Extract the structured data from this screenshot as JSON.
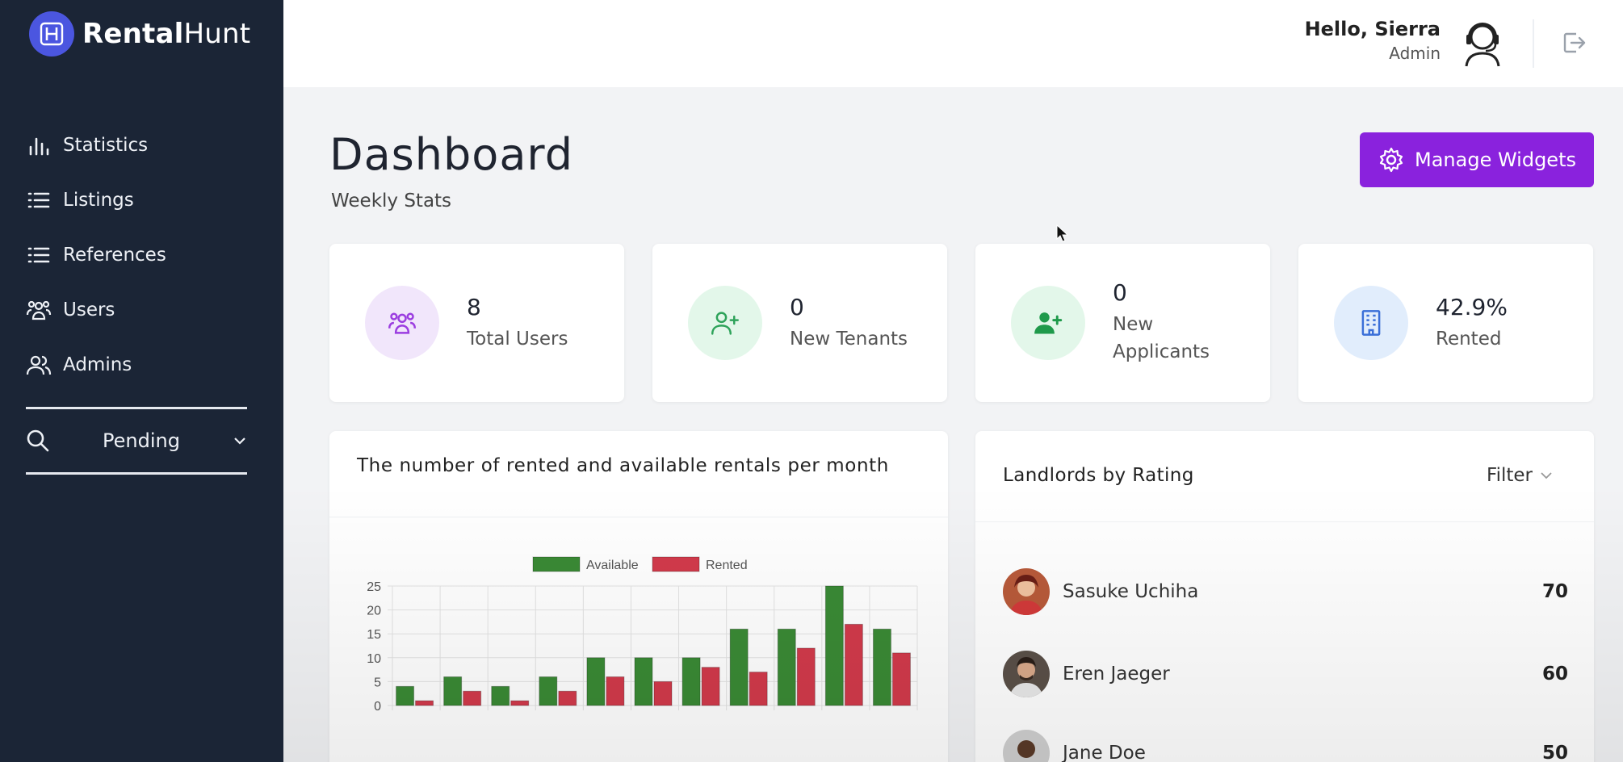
{
  "brand": {
    "bold": "Rental",
    "light": "Hunt"
  },
  "sidebar": {
    "items": [
      {
        "label": "Statistics",
        "icon": "bar-chart-icon"
      },
      {
        "label": "Listings",
        "icon": "list-icon"
      },
      {
        "label": "References",
        "icon": "list-icon"
      },
      {
        "label": "Users",
        "icon": "users-group-icon"
      },
      {
        "label": "Admins",
        "icon": "users-icon"
      }
    ],
    "pending": {
      "label": "Pending",
      "icon": "search-icon"
    }
  },
  "header": {
    "greeting": "Hello, Sierra",
    "role": "Admin"
  },
  "page": {
    "title": "Dashboard",
    "subtitle": "Weekly Stats",
    "manage_label": "Manage Widgets"
  },
  "stats": [
    {
      "value": "8",
      "label": "Total Users",
      "icon": "users-group-icon",
      "bg": "#f1e6fb",
      "fg": "#9b3de0"
    },
    {
      "value": "0",
      "label": "New Tenants",
      "icon": "user-plus-outline-icon",
      "bg": "#e3f7ea",
      "fg": "#2ea35a"
    },
    {
      "value": "0",
      "label": "New Applicants",
      "icon": "user-plus-solid-icon",
      "bg": "#e3f7ea",
      "fg": "#1f9a4b"
    },
    {
      "value": "42.9%",
      "label": "Rented",
      "icon": "building-icon",
      "bg": "#e1edfc",
      "fg": "#3a6fd8"
    }
  ],
  "chart_title": "The number of rented and available rentals per month",
  "chart_data": {
    "type": "bar",
    "categories": [
      "",
      "",
      "",
      "",
      "",
      "",
      "",
      "",
      "",
      "",
      ""
    ],
    "series": [
      {
        "name": "Available",
        "color": "#3a8a35",
        "values": [
          4,
          6,
          4,
          6,
          10,
          10,
          10,
          16,
          16,
          25,
          16
        ]
      },
      {
        "name": "Rented",
        "color": "#d23a4b",
        "values": [
          1,
          3,
          1,
          3,
          6,
          5,
          8,
          7,
          12,
          17,
          11
        ]
      }
    ],
    "ylim": [
      0,
      25
    ],
    "yticks": [
      "25",
      "20",
      "15",
      "10",
      "5",
      "0"
    ],
    "grid": true,
    "legend": "top"
  },
  "landlords": {
    "title": "Landlords by Rating",
    "filter_label": "Filter",
    "rows": [
      {
        "name": "Sasuke Uchiha",
        "score": "70"
      },
      {
        "name": "Eren Jaeger",
        "score": "60"
      },
      {
        "name": "Jane Doe",
        "score": "50"
      }
    ]
  },
  "colors": {
    "sidebar": "#1b2536",
    "accent": "#8a22dd",
    "brand": "#4b56e0"
  }
}
